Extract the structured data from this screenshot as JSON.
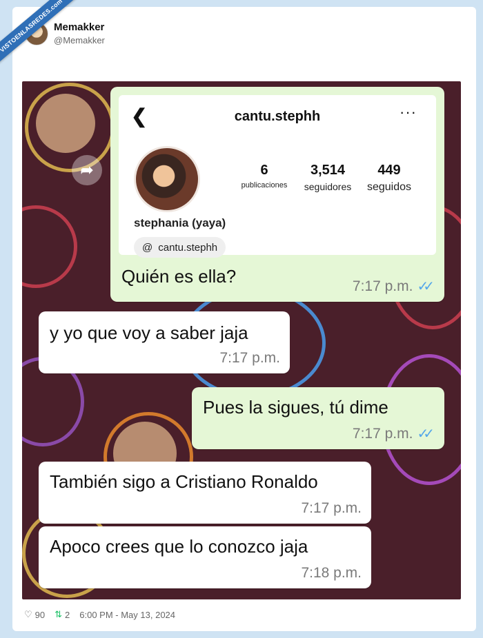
{
  "ribbon_text": "VISTOENLASREDES.com",
  "author": {
    "name": "Memakker",
    "handle": "@Memakker"
  },
  "profile": {
    "username": "cantu.stephh",
    "stats": [
      {
        "value": "6",
        "label": "publicaciones"
      },
      {
        "value": "3,514",
        "label": "seguidores"
      },
      {
        "value": "449",
        "label": "seguidos"
      }
    ],
    "display_name": "stephania (yaya)",
    "threads_handle": "cantu.stephh",
    "back_icon": "chevron-left-icon",
    "more_icon": "more-icon"
  },
  "messages": [
    {
      "text": "Quién es ella?",
      "time": "7:17 p.m.",
      "direction": "out",
      "read": true
    },
    {
      "text": "y yo que voy a saber jaja",
      "time": "7:17 p.m.",
      "direction": "in"
    },
    {
      "text": "Pues la sigues, tú dime",
      "time": "7:17 p.m.",
      "direction": "out",
      "read": true
    },
    {
      "text": "También sigo a Cristiano Ronaldo",
      "time": "7:17 p.m.",
      "direction": "in"
    },
    {
      "text": "Apoco crees que lo conozco jaja",
      "time": "7:18 p.m.",
      "direction": "in"
    }
  ],
  "tweet_footer": {
    "likes": "90",
    "retweets": "2",
    "timestamp": "6:00 PM - May 13, 2024"
  },
  "colors": {
    "outgoing": "#e5f7d6",
    "incoming": "#ffffff",
    "wallpaper": "#4a1f2a",
    "ticks": "#53a6ea"
  }
}
